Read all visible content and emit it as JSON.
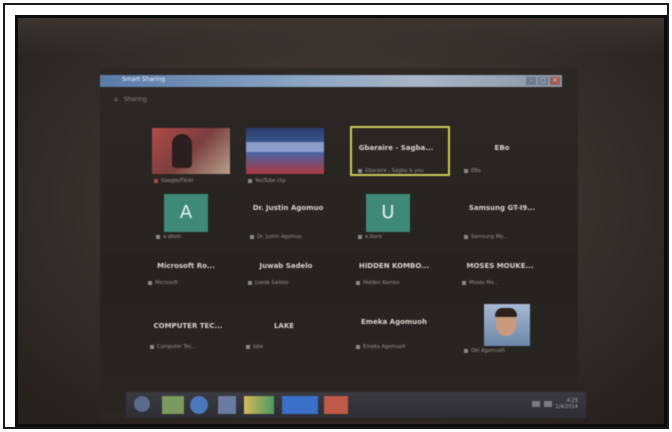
{
  "window": {
    "title": "Smart Sharing"
  },
  "breadcrumb": [
    "Sharing"
  ],
  "tiles_row1": [
    {
      "type": "video-red",
      "caption": "Google/Flickr"
    },
    {
      "type": "video-blue",
      "caption": "YouTube clip"
    },
    {
      "type": "selected",
      "name": "Gbaraire - Sagba...",
      "caption": "Gbaraire - Sagba & you"
    },
    {
      "type": "text",
      "name": "EBo",
      "caption": "EBo"
    }
  ],
  "tiles_row2": [
    {
      "type": "letter",
      "letter": "A",
      "caption": "a.aboki"
    },
    {
      "type": "text",
      "name": "Dr. Justin Agomuo",
      "caption": "Dr. Justin Agomuo"
    },
    {
      "type": "letter",
      "letter": "U",
      "caption": "a.ikoro"
    },
    {
      "type": "text",
      "name": "Samsung GT-I9...",
      "caption": "Samsung Mo..."
    }
  ],
  "tiles_row3": [
    {
      "type": "text",
      "name": "Microsoft Ro...",
      "caption": "Microsoft"
    },
    {
      "type": "text",
      "name": "Juwab Sadelo",
      "caption": "Juwab Sadelo"
    },
    {
      "type": "text",
      "name": "HIDDEN KOMBO...",
      "caption": "Hidden Kombo"
    },
    {
      "type": "text",
      "name": "MOSES MOUKE...",
      "caption": "Moses Mo..."
    }
  ],
  "tiles_row4": [
    {
      "type": "text",
      "name": "COMPUTER TEC...",
      "caption": "Computer Tec..."
    },
    {
      "type": "text",
      "name": "LAKE",
      "caption": "lake"
    },
    {
      "type": "text",
      "name": "Emeka Agomuoh",
      "caption": "Emeka Agomuoh"
    },
    {
      "type": "photo",
      "caption": "Obi Agomuoh"
    }
  ],
  "taskbar": {
    "clock_time": "4:25",
    "clock_date": "1/4/2014"
  }
}
